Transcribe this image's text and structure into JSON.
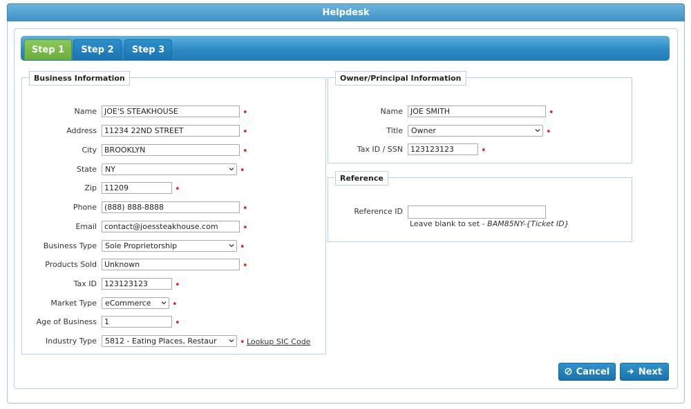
{
  "window": {
    "title": "Helpdesk"
  },
  "tabs": [
    {
      "label": "Step 1"
    },
    {
      "label": "Step 2"
    },
    {
      "label": "Step 3"
    }
  ],
  "business": {
    "legend": "Business Information",
    "name_label": "Name",
    "name_value": "JOE'S STEAKHOUSE",
    "address_label": "Address",
    "address_value": "11234 22ND STREET",
    "city_label": "City",
    "city_value": "BROOKLYN",
    "state_label": "State",
    "state_value": "NY",
    "zip_label": "Zip",
    "zip_value": "11209",
    "phone_label": "Phone",
    "phone_value": "(888) 888-8888",
    "email_label": "Email",
    "email_value": "contact@joessteakhouse.com",
    "business_type_label": "Business Type",
    "business_type_value": "Sole Proprietorship",
    "products_label": "Products Sold",
    "products_value": "Unknown",
    "tax_id_label": "Tax ID",
    "tax_id_value": "123123123",
    "market_type_label": "Market Type",
    "market_type_value": "eCommerce",
    "age_label": "Age of Business",
    "age_value": "1",
    "industry_label": "Industry Type",
    "industry_value": "5812 - Eating Places, Restaur",
    "lookup_link": "Lookup SIC Code"
  },
  "owner": {
    "legend": "Owner/Principal Information",
    "name_label": "Name",
    "name_value": "JOE SMITH",
    "title_label": "Title",
    "title_value": "Owner",
    "taxid_label": "Tax ID / SSN",
    "taxid_value": "123123123"
  },
  "reference": {
    "legend": "Reference",
    "id_label": "Reference ID",
    "id_value": "",
    "help_prefix": "Leave blank to set - ",
    "help_example": "BAM85NY-{Ticket ID}"
  },
  "actions": {
    "cancel_label": "Cancel",
    "cancel_icon": "cancel-circle-icon",
    "next_label": "Next",
    "next_icon": "arrow-right-icon"
  },
  "colors": {
    "accent_blue": "#2e8ac3",
    "active_tab_green": "#6aad3a",
    "required_red": "#e02020"
  }
}
